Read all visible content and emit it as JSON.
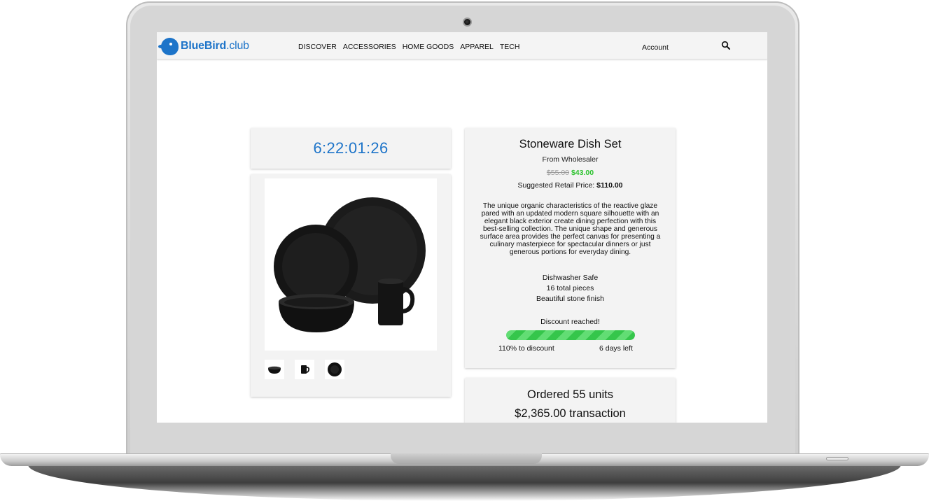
{
  "brand": {
    "name_main": "BlueBird",
    "name_suffix": ".club"
  },
  "nav": {
    "links": [
      "DISCOVER",
      "ACCESSORIES",
      "HOME GOODS",
      "APPAREL",
      "TECH"
    ],
    "account": "Account",
    "search_icon": "search-icon"
  },
  "timer": {
    "value": "6:22:01:26"
  },
  "product": {
    "title": "Stoneware Dish Set",
    "from": "From Wholesaler",
    "old_price": "$55.00",
    "new_price": "$43.00",
    "retail_label": "Suggested Retail Price:",
    "retail_price": "$110.00",
    "description": "The unique organic characteristics of the reactive glaze pared with an updated modern square silhouette with an elegant black exterior create dining perfection with this best-selling collection. The unique shape and generous surface area provides the perfect canvas for presenting a culinary masterpiece for spectacular dinners or just generous portions for everyday dining.",
    "features": [
      "Dishwasher Safe",
      "16 total pieces",
      "Beautiful stone finish"
    ]
  },
  "discount": {
    "status": "Discount reached!",
    "progress_fraction": 1.0,
    "percent_text": "110% to discount",
    "time_left": "6 days left",
    "bar_color": "#35c64b"
  },
  "order": {
    "units_text": "Ordered 55 units",
    "amount_text": "$2,365.00 transaction"
  },
  "colors": {
    "accent": "#1d74c9",
    "sale_price": "#2fc331"
  },
  "thumbnails": [
    "bowl-thumbnail",
    "mug-thumbnail",
    "plate-thumbnail"
  ]
}
